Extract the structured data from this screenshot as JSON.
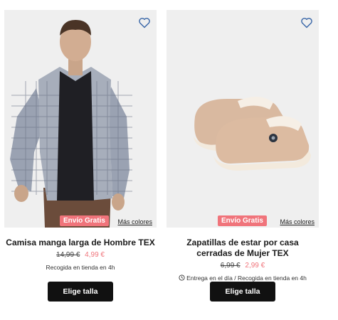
{
  "products": [
    {
      "image_alt": "Hombre con camisa de cuadros",
      "badge": "Envío Gratis",
      "more_colors": "Más colores",
      "title": "Camisa manga larga de Hombre TEX",
      "old_price": "14,99 €",
      "new_price": "4,99 €",
      "delivery": "Recogida en tienda en 4h",
      "button": "Elige talla"
    },
    {
      "image_alt": "Zapatillas de estar por casa beige",
      "badge": "Envío Gratis",
      "more_colors": "Más colores",
      "title": "Zapatillas de estar por casa cerradas de Mujer TEX",
      "old_price": "6,99 €",
      "new_price": "2,99 €",
      "delivery": "Entrega en el día / Recogida en tienda en 4h",
      "button": "Elige talla"
    }
  ],
  "colors": {
    "badge": "#f0747b",
    "heart": "#3a67a8",
    "button_bg": "#111111",
    "sale_price": "#f0747b"
  },
  "icons": [
    "heart-icon",
    "clock-icon"
  ]
}
